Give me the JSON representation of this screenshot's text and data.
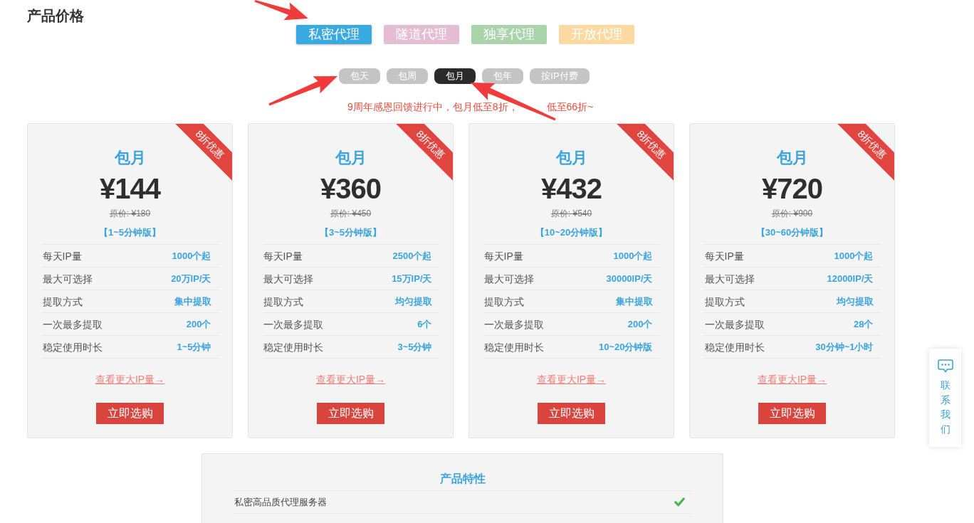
{
  "page_title": "产品价格",
  "product_tabs": [
    {
      "label": "私密代理",
      "selected": true,
      "color": "#39a9e1"
    },
    {
      "label": "隧道代理",
      "selected": false,
      "color": "#e5bdd3"
    },
    {
      "label": "独享代理",
      "selected": false,
      "color": "#a9d4a9"
    },
    {
      "label": "开放代理",
      "selected": false,
      "color": "#fcd9a1"
    }
  ],
  "periods": [
    {
      "label": "包天",
      "selected": false
    },
    {
      "label": "包周",
      "selected": false
    },
    {
      "label": "包月",
      "selected": true
    },
    {
      "label": "包年",
      "selected": false
    },
    {
      "label": "按IP付费",
      "selected": false
    }
  ],
  "promo_text_parts": [
    "9周年感恩回馈进行中，包月低至8折，",
    "低至66折~"
  ],
  "plans": [
    {
      "ribbon": "8折优惠",
      "period": "包月",
      "price": "¥144",
      "original_price": "原价: ¥180",
      "version": "【1~5分钟版】",
      "specs": [
        {
          "label": "每天IP量",
          "value": "1000个起"
        },
        {
          "label": "最大可选择",
          "value": "20万IP/天"
        },
        {
          "label": "提取方式",
          "value": "集中提取"
        },
        {
          "label": "一次最多提取",
          "value": "200个"
        },
        {
          "label": "稳定使用时长",
          "value": "1~5分钟"
        }
      ],
      "more_link": "查看更大IP量→",
      "buy_button": "立即选购"
    },
    {
      "ribbon": "8折优惠",
      "period": "包月",
      "price": "¥360",
      "original_price": "原价: ¥450",
      "version": "【3~5分钟版】",
      "specs": [
        {
          "label": "每天IP量",
          "value": "2500个起"
        },
        {
          "label": "最大可选择",
          "value": "15万IP/天"
        },
        {
          "label": "提取方式",
          "value": "均匀提取"
        },
        {
          "label": "一次最多提取",
          "value": "6个"
        },
        {
          "label": "稳定使用时长",
          "value": "3~5分钟"
        }
      ],
      "more_link": "查看更大IP量→",
      "buy_button": "立即选购"
    },
    {
      "ribbon": "8折优惠",
      "period": "包月",
      "price": "¥432",
      "original_price": "原价: ¥540",
      "version": "【10~20分钟版】",
      "specs": [
        {
          "label": "每天IP量",
          "value": "1000个起"
        },
        {
          "label": "最大可选择",
          "value": "30000IP/天"
        },
        {
          "label": "提取方式",
          "value": "集中提取"
        },
        {
          "label": "一次最多提取",
          "value": "200个"
        },
        {
          "label": "稳定使用时长",
          "value": "10~20分钟版"
        }
      ],
      "more_link": "查看更大IP量→",
      "buy_button": "立即选购"
    },
    {
      "ribbon": "8折优惠",
      "period": "包月",
      "price": "¥720",
      "original_price": "原价: ¥900",
      "version": "【30~60分钟版】",
      "specs": [
        {
          "label": "每天IP量",
          "value": "1000个起"
        },
        {
          "label": "最大可选择",
          "value": "12000IP/天"
        },
        {
          "label": "提取方式",
          "value": "均匀提取"
        },
        {
          "label": "一次最多提取",
          "value": "28个"
        },
        {
          "label": "稳定使用时长",
          "value": "30分钟~1小时"
        }
      ],
      "more_link": "查看更大IP量→",
      "buy_button": "立即选购"
    }
  ],
  "features": {
    "title": "产品特性",
    "rows": [
      {
        "kind": "check",
        "label": "私密高品质代理服务器"
      }
    ]
  },
  "contact_button": {
    "label": "联系我们"
  }
}
